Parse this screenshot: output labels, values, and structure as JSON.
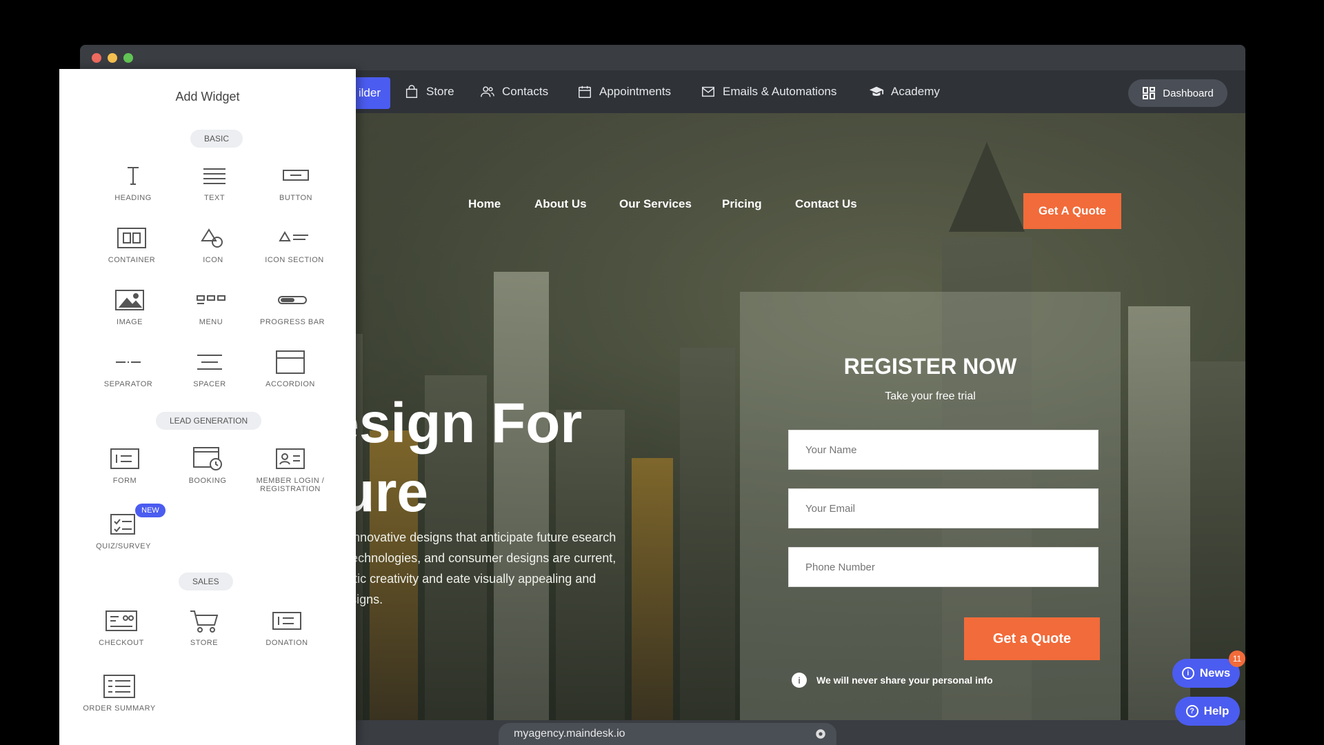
{
  "app_nav": {
    "builder_label": "ilder",
    "items": [
      {
        "label": "Store",
        "icon": "bag-icon"
      },
      {
        "label": "Contacts",
        "icon": "users-icon"
      },
      {
        "label": "Appointments",
        "icon": "calendar-icon"
      },
      {
        "label": "Emails & Automations",
        "icon": "mail-icon"
      },
      {
        "label": "Academy",
        "icon": "graduation-cap-icon"
      }
    ],
    "dashboard_label": "Dashboard"
  },
  "site": {
    "nav": [
      "Home",
      "About Us",
      "Our Services",
      "Pricing",
      "Contact Us"
    ],
    "cta_top": "Get A Quote",
    "hero_title": "Design For\nuture",
    "hero_text": "uturistic and innovative designs that anticipate future esearch new trends, technologies, and consumer designs are current, blending artistic creativity and eate visually appealing and functional designs.",
    "register": {
      "title": "REGISTER NOW",
      "subtitle": "Take your free trial",
      "name_placeholder": "Your Name",
      "email_placeholder": "Your Email",
      "phone_placeholder": "Phone Number",
      "submit": "Get a Quote",
      "privacy": "We will never share your personal info"
    }
  },
  "panel": {
    "title": "Add Widget",
    "sections": {
      "basic": "BASIC",
      "lead": "LEAD GENERATION",
      "sales": "SALES"
    },
    "basic_widgets": [
      "HEADING",
      "TEXT",
      "BUTTON",
      "CONTAINER",
      "ICON",
      "ICON SECTION",
      "IMAGE",
      "MENU",
      "PROGRESS BAR",
      "SEPARATOR",
      "SPACER",
      "ACCORDION"
    ],
    "lead_widgets": [
      "FORM",
      "BOOKING",
      "MEMBER LOGIN / REGISTRATION",
      "QUIZ/SURVEY"
    ],
    "new_badge": "NEW",
    "sales_widgets": [
      "CHECKOUT",
      "STORE",
      "DONATION",
      "ORDER SUMMARY"
    ]
  },
  "bottom": {
    "url": "myagency.maindesk.io"
  },
  "floating": {
    "news": "News",
    "news_count": "11",
    "help": "Help"
  },
  "colors": {
    "accent": "#4b5cf0",
    "cta": "#f26b3a"
  }
}
